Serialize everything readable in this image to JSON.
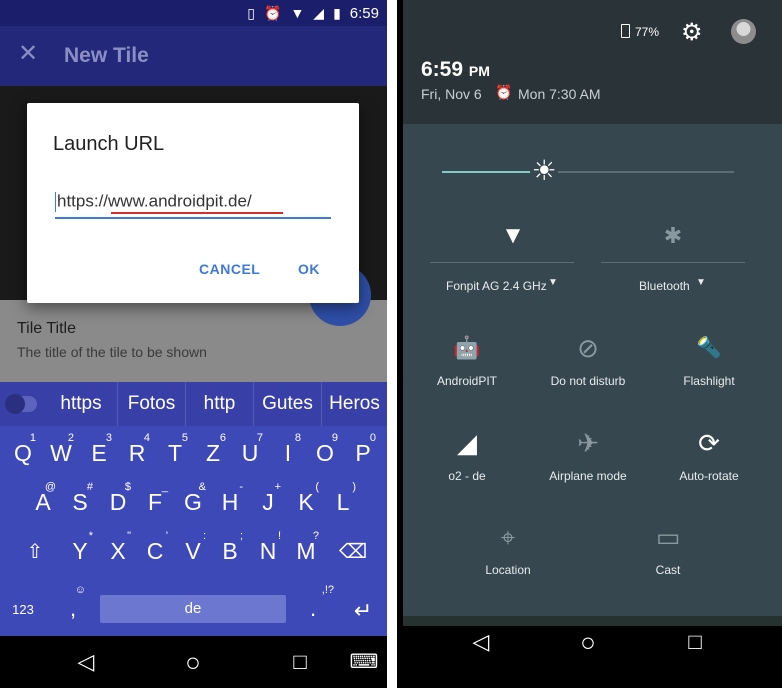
{
  "left": {
    "status": {
      "time": "6:59",
      "icons": [
        "vibrate-icon",
        "alarm-icon",
        "wifi-icon",
        "signal-icon",
        "battery-icon"
      ]
    },
    "appbar": {
      "close_glyph": "✕",
      "title": "New Tile"
    },
    "tile": {
      "title": "Tile Title",
      "subtitle": "The title of the tile to be shown"
    },
    "dialog": {
      "title": "Launch URL",
      "input_value": "https://www.androidpit.de/",
      "cancel_label": "CANCEL",
      "ok_label": "OK"
    },
    "suggestions": [
      "https",
      "Fotos",
      "http",
      "Gutes",
      "Heros"
    ],
    "keyboard": {
      "row1": [
        {
          "k": "Q",
          "h": "1"
        },
        {
          "k": "W",
          "h": "2"
        },
        {
          "k": "E",
          "h": "3"
        },
        {
          "k": "R",
          "h": "4"
        },
        {
          "k": "T",
          "h": "5"
        },
        {
          "k": "Z",
          "h": "6"
        },
        {
          "k": "U",
          "h": "7"
        },
        {
          "k": "I",
          "h": "8"
        },
        {
          "k": "O",
          "h": "9"
        },
        {
          "k": "P",
          "h": "0"
        }
      ],
      "row2": [
        {
          "k": "A",
          "h": "@"
        },
        {
          "k": "S",
          "h": "#"
        },
        {
          "k": "D",
          "h": "$"
        },
        {
          "k": "F",
          "h": "_"
        },
        {
          "k": "G",
          "h": "&"
        },
        {
          "k": "H",
          "h": "-"
        },
        {
          "k": "J",
          "h": "+"
        },
        {
          "k": "K",
          "h": "("
        },
        {
          "k": "L",
          "h": ")"
        }
      ],
      "row3": [
        {
          "k": "Y",
          "h": "*"
        },
        {
          "k": "X",
          "h": "\""
        },
        {
          "k": "C",
          "h": "'"
        },
        {
          "k": "V",
          "h": ":"
        },
        {
          "k": "B",
          "h": ";"
        },
        {
          "k": "N",
          "h": "!"
        },
        {
          "k": "M",
          "h": "?"
        }
      ],
      "shift_glyph": "⇧",
      "delete_glyph": "⌫",
      "num_label": "123",
      "comma_label": ",",
      "emoji_hint": "☺",
      "space_label": "de",
      "period_label": ".",
      "period_hint": ",!?",
      "enter_glyph": "↵"
    },
    "nav": {
      "back": "◁",
      "home": "○",
      "recents": "□",
      "keyboard": "⌨"
    }
  },
  "right": {
    "header": {
      "battery": "77%",
      "time": "6:59",
      "ampm": "PM",
      "date": "Fri, Nov 6",
      "alarm_glyph": "⏰",
      "alarm": "Mon 7:30 AM"
    },
    "brightness": {
      "level": 0.35,
      "thumb_glyph": "☀"
    },
    "tiles": {
      "wifi": {
        "label": "Fonpit AG 2.4 GHz",
        "glyph": "▼",
        "icon": "wifi-icon"
      },
      "bluetooth": {
        "label": "Bluetooth",
        "glyph": "✱",
        "icon": "bluetooth-icon"
      },
      "androidpit": {
        "label": "AndroidPIT",
        "glyph": "🤖",
        "icon": "android-icon"
      },
      "dnd": {
        "label": "Do not disturb",
        "glyph": "⊘",
        "icon": "do-not-disturb-icon"
      },
      "flashlight": {
        "label": "Flashlight",
        "glyph": "🔦",
        "icon": "flashlight-icon"
      },
      "cell": {
        "label": "o2 - de",
        "glyph": "◢",
        "icon": "cell-signal-icon"
      },
      "airplane": {
        "label": "Airplane mode",
        "glyph": "✈",
        "icon": "airplane-icon"
      },
      "rotate": {
        "label": "Auto-rotate",
        "glyph": "⟳",
        "icon": "auto-rotate-icon"
      },
      "location": {
        "label": "Location",
        "glyph": "⌖",
        "icon": "location-icon"
      },
      "cast": {
        "label": "Cast",
        "glyph": "▭",
        "icon": "cast-icon"
      }
    },
    "nav": {
      "back": "◁",
      "home": "○",
      "recents": "□"
    }
  }
}
